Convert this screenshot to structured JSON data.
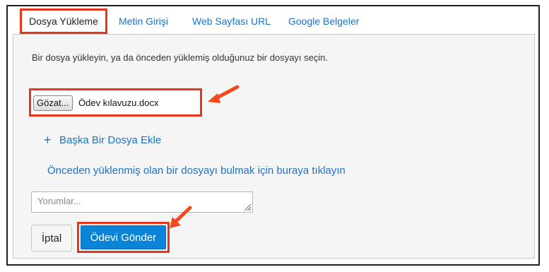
{
  "tabs": [
    {
      "label": "Dosya Yükleme",
      "active": true
    },
    {
      "label": "Metin Girişi",
      "active": false
    },
    {
      "label": "Web Sayfası URL",
      "active": false
    },
    {
      "label": "Google Belgeler",
      "active": false
    }
  ],
  "instructions": "Bir dosya yükleyin, ya da önceden yüklemiş olduğunuz bir dosyayı seçin.",
  "file_input": {
    "button_label": "Gözat...",
    "file_name": "Ödev kılavuzu.docx"
  },
  "add_file": {
    "icon": "plus-icon",
    "label": "Başka Bir Dosya Ekle"
  },
  "find_previous_link": "Önceden yüklenmiş olan bir dosyayı bulmak için buraya tıklayın",
  "comments": {
    "placeholder": "Yorumlar...",
    "value": ""
  },
  "actions": {
    "cancel_label": "İptal",
    "submit_label": "Ödevi Gönder"
  },
  "colors": {
    "link": "#1a73c8",
    "highlight": "#e8351e",
    "primary_button": "#0b84d8",
    "panel_background": "#f5f5f5"
  }
}
